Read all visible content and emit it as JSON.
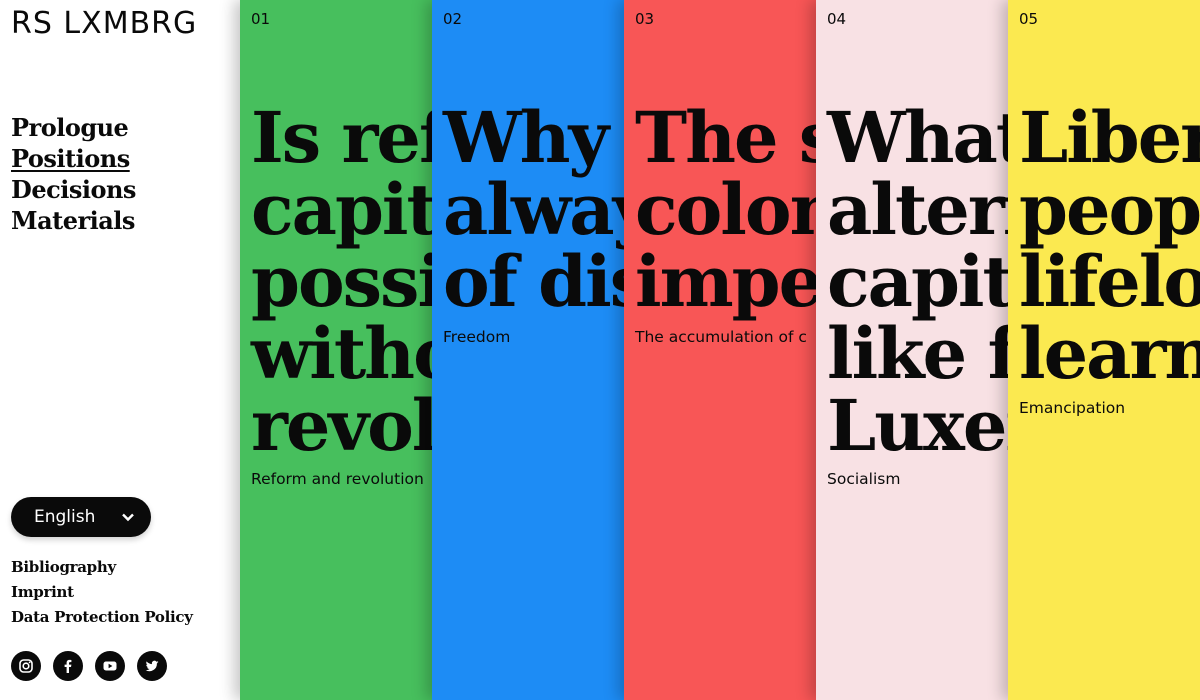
{
  "brand": {
    "logo": "RS LXMBRG"
  },
  "nav": [
    {
      "label": "Prologue",
      "active": false
    },
    {
      "label": "Positions",
      "active": true
    },
    {
      "label": "Decisions",
      "active": false
    },
    {
      "label": "Materials",
      "active": false
    }
  ],
  "language": {
    "selected": "English",
    "icon": "chevron-down-icon"
  },
  "footer_links": [
    "Bibliography",
    "Imprint",
    "Data Protection Policy"
  ],
  "social": [
    "instagram-icon",
    "facebook-icon",
    "youtube-icon",
    "twitter-icon"
  ],
  "panels": [
    {
      "number": "01",
      "color": "#47bf5d",
      "lines": [
        "Is refo",
        "capita",
        "possil",
        "witho",
        "revolu"
      ],
      "topic": "Reform and revolution"
    },
    {
      "number": "02",
      "color": "#1d8cf5",
      "lines": [
        "Why i",
        "alway",
        "of dis"
      ],
      "topic": "Freedom"
    },
    {
      "number": "03",
      "color": "#f85656",
      "lines": [
        "The so",
        "colon",
        "imper"
      ],
      "topic": "The accumulation of c"
    },
    {
      "number": "04",
      "color": "#f8e1e4",
      "lines": [
        "What",
        "altern",
        "capita",
        "like fo",
        "Luxen"
      ],
      "topic": "Socialism"
    },
    {
      "number": "05",
      "color": "#fbe950",
      "lines": [
        "Libera",
        "peopl",
        "lifelon",
        "learni"
      ],
      "topic": "Emancipation"
    }
  ]
}
